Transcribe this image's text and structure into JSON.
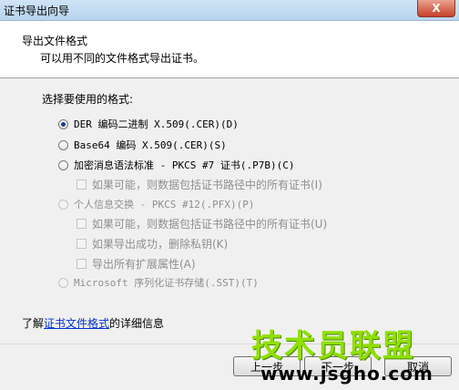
{
  "window": {
    "title": "证书导出向导",
    "close_label": "X"
  },
  "header": {
    "title": "导出文件格式",
    "subtitle": "可以用不同的文件格式导出证书。"
  },
  "section_label": "选择要使用的格式:",
  "options": {
    "der": "DER 编码二进制 X.509(.CER)(D)",
    "base64": "Base64 编码 X.509(.CER)(S)",
    "pkcs7": "加密消息语法标准 - PKCS #7 证书(.P7B)(C)",
    "pkcs7_include": "如果可能，则数据包括证书路径中的所有证书(I)",
    "pfx": "个人信息交换 - PKCS #12(.PFX)(P)",
    "pfx_include": "如果可能，则数据包括证书路径中的所有证书(U)",
    "pfx_delete": "如果导出成功，删除私钥(K)",
    "pfx_export_all": "导出所有扩展属性(A)",
    "sst": "Microsoft 序列化证书存储(.SST)(T)"
  },
  "learn_more": {
    "prefix": "了解",
    "link": "证书文件格式",
    "suffix": "的详细信息"
  },
  "buttons": {
    "back": "上一步",
    "next": "下一步",
    "cancel": "取消"
  },
  "watermark": {
    "chinese": "技术员联盟",
    "url": "www.jsgho.com"
  }
}
